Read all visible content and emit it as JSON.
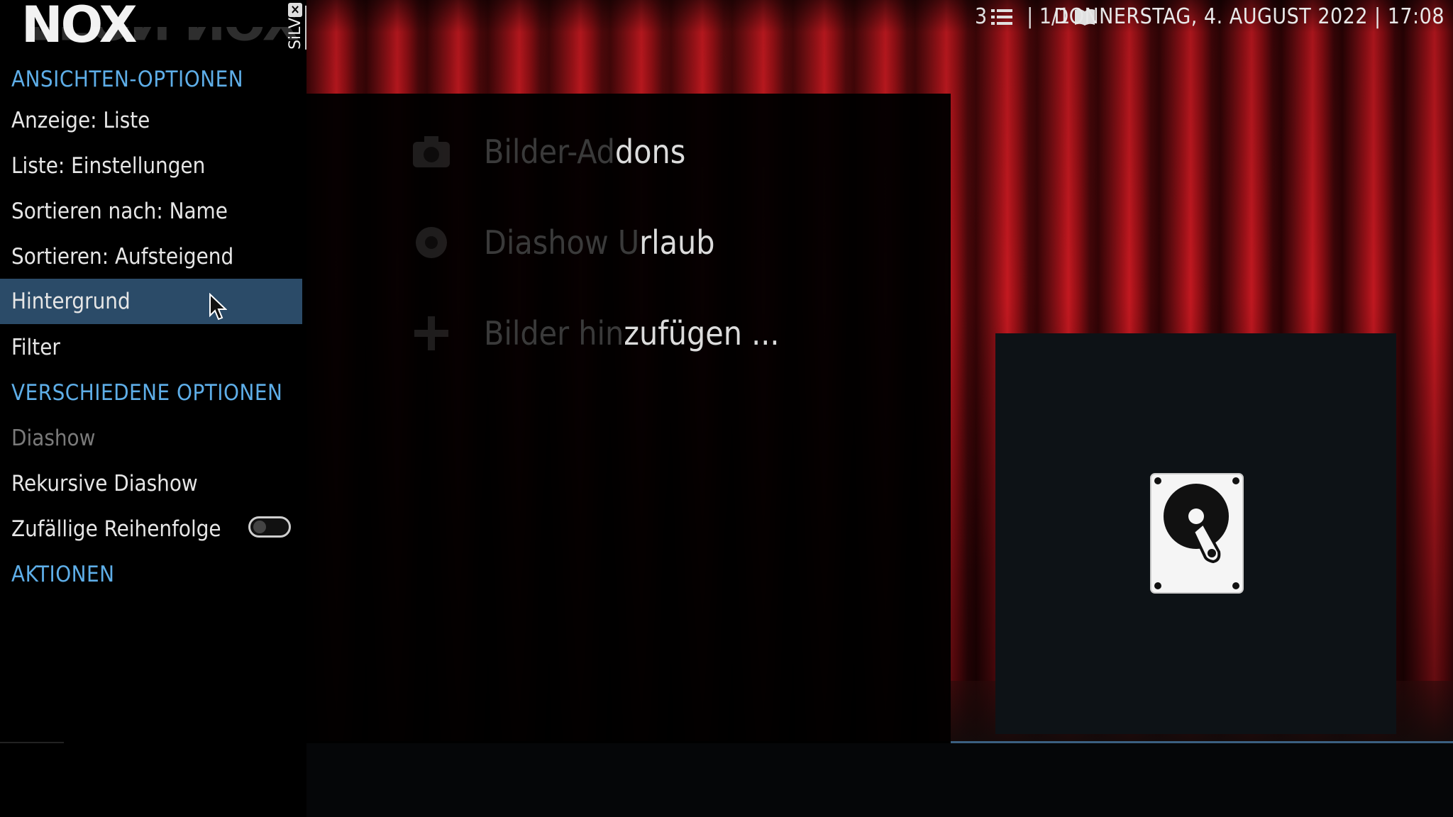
{
  "topbar": {
    "item_count": "3",
    "page_indicator": "| 1/1",
    "datetime": "DONNERSTAG, 4. AUGUST 2022 | 17:08"
  },
  "logo": {
    "title": "AEON NOX",
    "subtitle": "SiLVO"
  },
  "list": {
    "items": [
      {
        "hidden_part": "Bilder-Ad",
        "visible_part": "dons",
        "icon": "camera-icon"
      },
      {
        "hidden_part": "Diashow U",
        "visible_part": "rlaub",
        "icon": "camera-icon"
      },
      {
        "hidden_part": "Bilder hin",
        "visible_part": "zufügen ...",
        "icon": "plus-icon"
      }
    ]
  },
  "sidebar": {
    "section1": "ANSICHTEN-OPTIONEN",
    "view_mode": "Anzeige: Liste",
    "list_settings": "Liste: Einstellungen",
    "sort_by": "Sortieren nach: Name",
    "sort_order": "Sortieren: Aufsteigend",
    "background": "Hintergrund",
    "filter": "Filter",
    "section2": "VERSCHIEDENE OPTIONEN",
    "slideshow": "Diashow",
    "recursive_slideshow": "Rekursive Diashow",
    "random_order": "Zufällige Reihenfolge",
    "random_order_enabled": false,
    "section3": "AKTIONEN"
  },
  "colors": {
    "accent": "#5eaee8",
    "selected_bg": "#2b4b68"
  }
}
